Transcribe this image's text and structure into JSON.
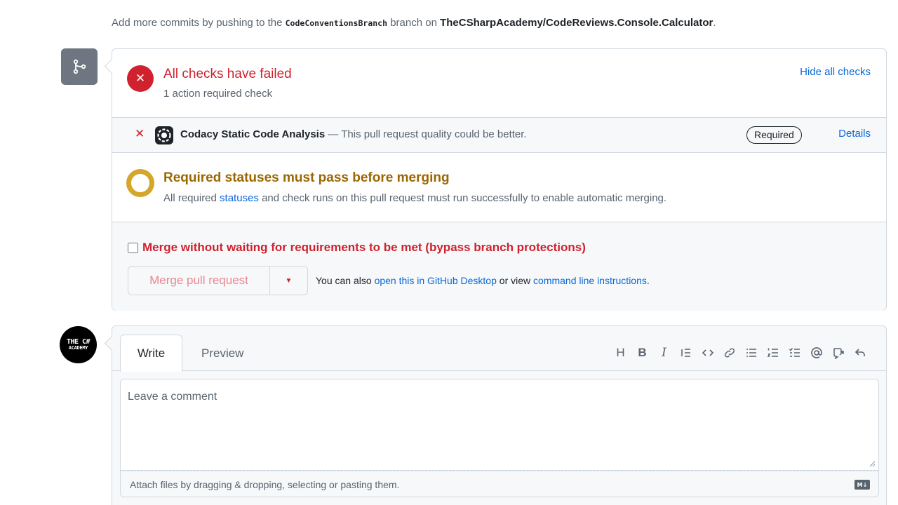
{
  "note": {
    "prefix": "Add more commits by pushing to the",
    "branch": "CodeConventionsBranch",
    "middle": "branch on",
    "repo": "TheCSharpAcademy/CodeReviews.Console.Calculator",
    "suffix": "."
  },
  "checks": {
    "title": "All checks have failed",
    "subtitle": "1 action required check",
    "hide_link": "Hide all checks",
    "fail_symbol": "✕"
  },
  "check_row": {
    "status_symbol": "✕",
    "name": "Codacy Static Code Analysis",
    "description": "— This pull request quality could be better.",
    "badge": "Required",
    "details_link": "Details"
  },
  "required_status": {
    "title": "Required statuses must pass before merging",
    "sub_prefix": "All required",
    "sub_link": "statuses",
    "sub_suffix": "and check runs on this pull request must run successfully to enable automatic merging."
  },
  "merge": {
    "bypass_label": "Merge without waiting for requirements to be met (bypass branch protections)",
    "button": "Merge pull request",
    "caret": "▼",
    "help_prefix": "You can also",
    "help_link_desktop": "open this in GitHub Desktop",
    "help_middle": "or view",
    "help_link_cli": "command line instructions",
    "help_suffix": "."
  },
  "avatar": {
    "line1": "THE C#",
    "line2": "ACADEMY"
  },
  "comment": {
    "tab_write": "Write",
    "tab_preview": "Preview",
    "placeholder": "Leave a comment",
    "attach_text": "Attach files by dragging & dropping, selecting or pasting them.",
    "markdown_badge": "M↓",
    "toolbar": {
      "heading": "H",
      "bold": "B",
      "italic": "I"
    }
  },
  "colors": {
    "danger": "#cf222e",
    "attention": "#d4a72c",
    "accent": "#0969da"
  }
}
